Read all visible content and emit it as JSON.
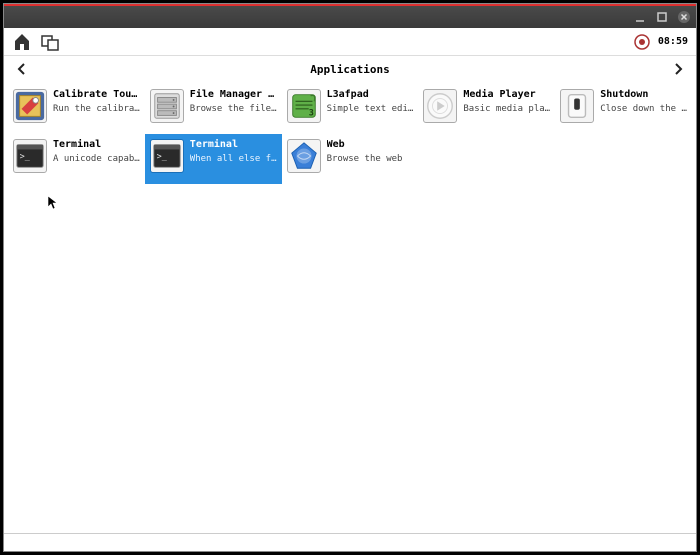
{
  "titlebar": {
    "minimize_label": "Minimize",
    "maximize_label": "Maximize",
    "close_label": "Close"
  },
  "toolbar": {
    "home_label": "Home",
    "windows_label": "Windows",
    "notification_label": "Notification",
    "clock": "08:59"
  },
  "nav": {
    "back_label": "Back",
    "forward_label": "Forward",
    "title": "Applications"
  },
  "apps": [
    {
      "id": "calibrate-touch",
      "name": "Calibrate Touch…",
      "desc": "Run the calibratio…",
      "icon": "calibrate",
      "selected": false
    },
    {
      "id": "file-manager",
      "name": "File Manager PC…",
      "desc": "Browse the file sy…",
      "icon": "file-manager",
      "selected": false
    },
    {
      "id": "leafpad",
      "name": "L3afpad",
      "desc": "Simple text editor",
      "icon": "leafpad",
      "selected": false
    },
    {
      "id": "media-player",
      "name": "Media Player",
      "desc": "Basic media player",
      "icon": "media-player",
      "selected": false
    },
    {
      "id": "shutdown",
      "name": "Shutdown",
      "desc": "Close down the mac…",
      "icon": "shutdown",
      "selected": false
    },
    {
      "id": "terminal-1",
      "name": "Terminal",
      "desc": "A unicode capable …",
      "icon": "terminal",
      "selected": false
    },
    {
      "id": "terminal-2",
      "name": "Terminal",
      "desc": "When all else fails.",
      "icon": "terminal",
      "selected": true
    },
    {
      "id": "web",
      "name": "Web",
      "desc": "Browse the web",
      "icon": "web",
      "selected": false
    }
  ]
}
